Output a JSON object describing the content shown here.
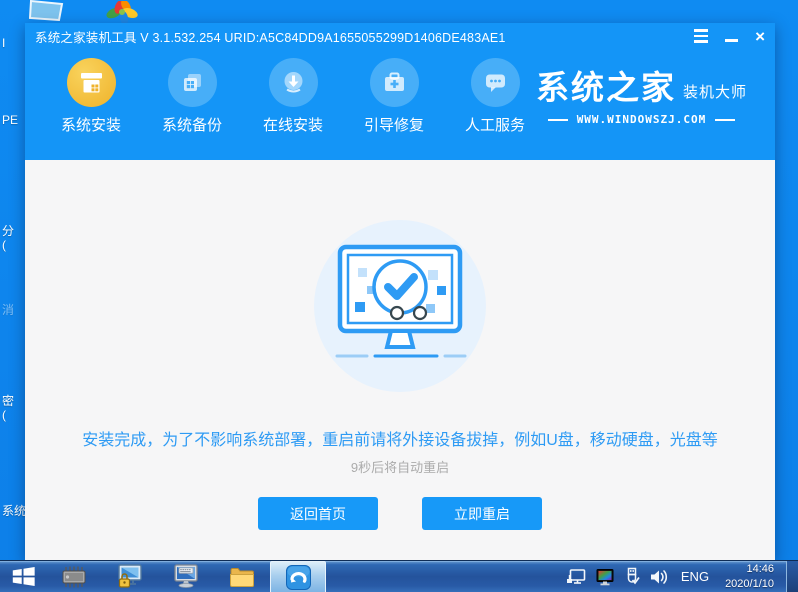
{
  "desktop": {
    "fragments": [
      {
        "text": "I"
      },
      {
        "text": "PE"
      },
      {
        "text": "分"
      },
      {
        "text": "("
      },
      {
        "text": "消"
      },
      {
        "text": "密"
      },
      {
        "text": "("
      },
      {
        "text": "系统"
      }
    ]
  },
  "window": {
    "titlebar": {
      "title": "系统之家装机工具 V 3.1.532.254 URID:A5C84DD9A1655055299D1406DE483AE1",
      "close_glyph": "×"
    },
    "nav": {
      "items": [
        {
          "label": "系统安装"
        },
        {
          "label": "系统备份"
        },
        {
          "label": "在线安装"
        },
        {
          "label": "引导修复"
        },
        {
          "label": "人工服务"
        }
      ],
      "logo": {
        "brand": "系统之家",
        "sub": "装机大师",
        "url": "WWW.WINDOWSZJ.COM"
      }
    },
    "main": {
      "message": "安装完成，为了不影响系统部署，重启前请将外接设备拔掉，例如U盘，移动硬盘，光盘等",
      "countdown": "9秒后将自动重启",
      "back_button": "返回首页",
      "restart_button": "立即重启"
    }
  },
  "taskbar": {
    "tray": {
      "language": "ENG",
      "time": "14:46",
      "date": "2020/1/10"
    }
  },
  "colors": {
    "header_blue": "#1495f7",
    "accent_blue": "#2e9bf4",
    "active_gold": "#efb22a",
    "button_blue": "#1799f8",
    "desktop_blue": "#0d84ee"
  }
}
